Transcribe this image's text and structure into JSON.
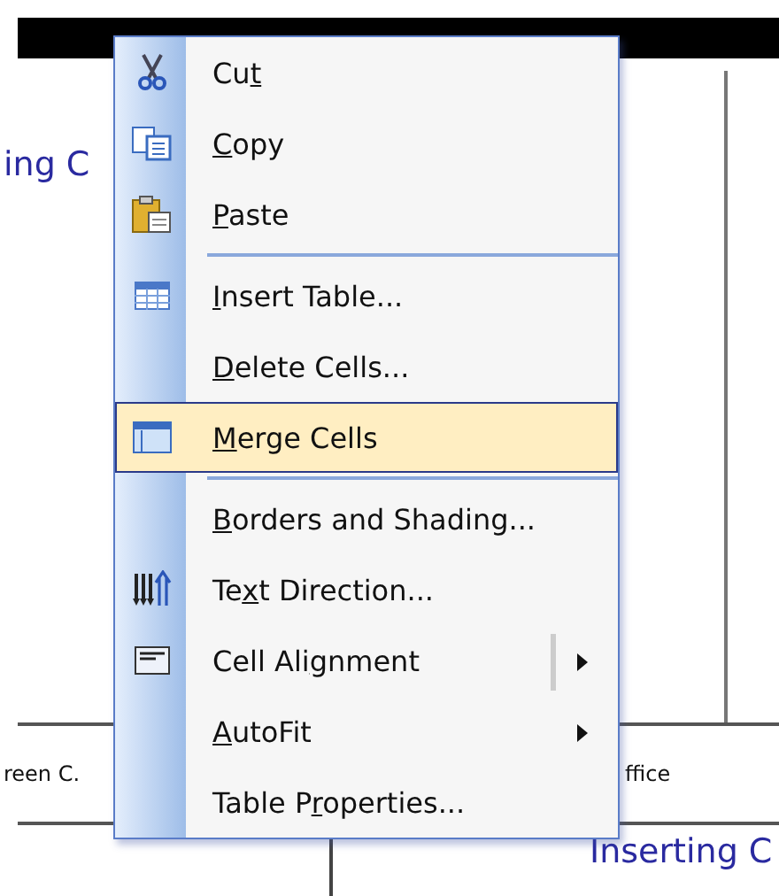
{
  "document": {
    "heading_left": "ing C",
    "cell_left": "reen C.",
    "cell_right": "ffice",
    "heading_bottom": "Inserting C"
  },
  "menu": [
    {
      "kind": "item",
      "label_before": "Cu",
      "access_key": "t",
      "selected": false
    },
    {
      "kind": "item",
      "access_key": "C",
      "label_after": "opy",
      "selected": false
    },
    {
      "kind": "item",
      "access_key": "P",
      "label_after": "aste",
      "selected": false
    },
    {
      "kind": "separator"
    },
    {
      "kind": "item",
      "access_key": "I",
      "label_after": "nsert Table...",
      "selected": false
    },
    {
      "kind": "item",
      "access_key": "D",
      "label_after": "elete Cells...",
      "selected": false
    },
    {
      "kind": "item",
      "access_key": "M",
      "label_after": "erge Cells",
      "selected": true
    },
    {
      "kind": "separator"
    },
    {
      "kind": "item",
      "access_key": "B",
      "label_after": "orders and Shading...",
      "selected": false
    },
    {
      "kind": "item",
      "label_before": "Te",
      "access_key": "x",
      "label_after": "t Direction...",
      "selected": false
    },
    {
      "kind": "split",
      "label_before": "Cell Ali",
      "access_key": "g",
      "label_after": "nment",
      "selected": false
    },
    {
      "kind": "submenu",
      "access_key": "A",
      "label_after": "utoFit",
      "selected": false
    },
    {
      "kind": "item",
      "label_before": "Table P",
      "access_key": "r",
      "label_after": "operties...",
      "selected": false
    }
  ]
}
